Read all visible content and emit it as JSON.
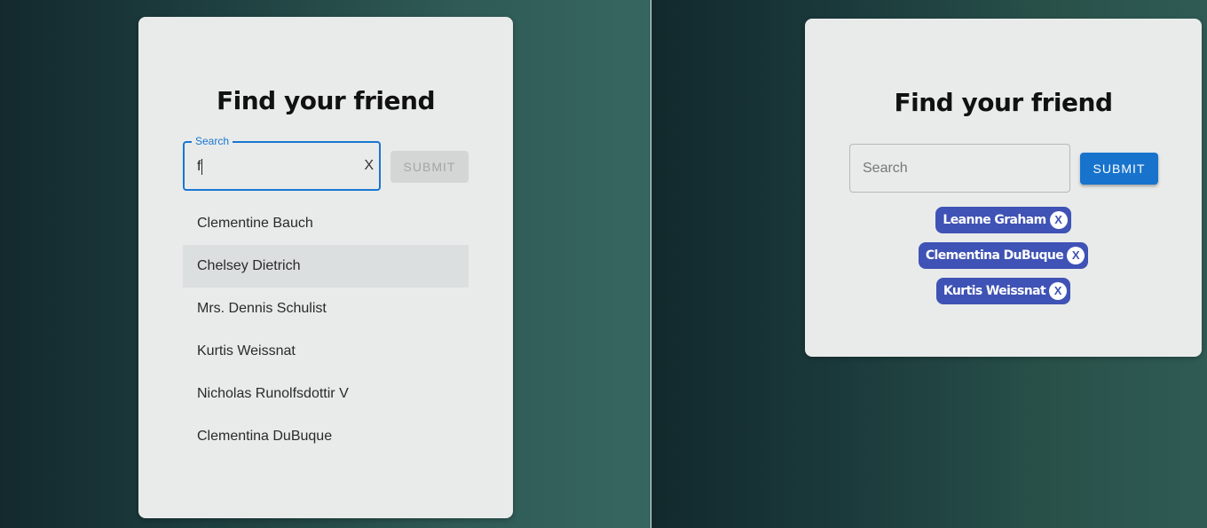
{
  "left": {
    "title": "Find your friend",
    "search": {
      "legend": "Search",
      "value": "f",
      "clear_label": "X"
    },
    "submit_label": "SUBMIT",
    "suggestions": [
      "Clementine Bauch",
      "Chelsey Dietrich",
      "Mrs. Dennis Schulist",
      "Kurtis Weissnat",
      "Nicholas Runolfsdottir V",
      "Clementina DuBuque"
    ]
  },
  "right": {
    "title": "Find your friend",
    "search": {
      "placeholder": "Search"
    },
    "submit_label": "SUBMIT",
    "chips": [
      {
        "label": "Leanne Graham",
        "remove": "X"
      },
      {
        "label": "Clementina DuBuque",
        "remove": "X"
      },
      {
        "label": "Kurtis Weissnat",
        "remove": "X"
      }
    ]
  },
  "colors": {
    "primary": "#1873cc",
    "chip": "#3f52b5",
    "focus": "#1976d2"
  }
}
